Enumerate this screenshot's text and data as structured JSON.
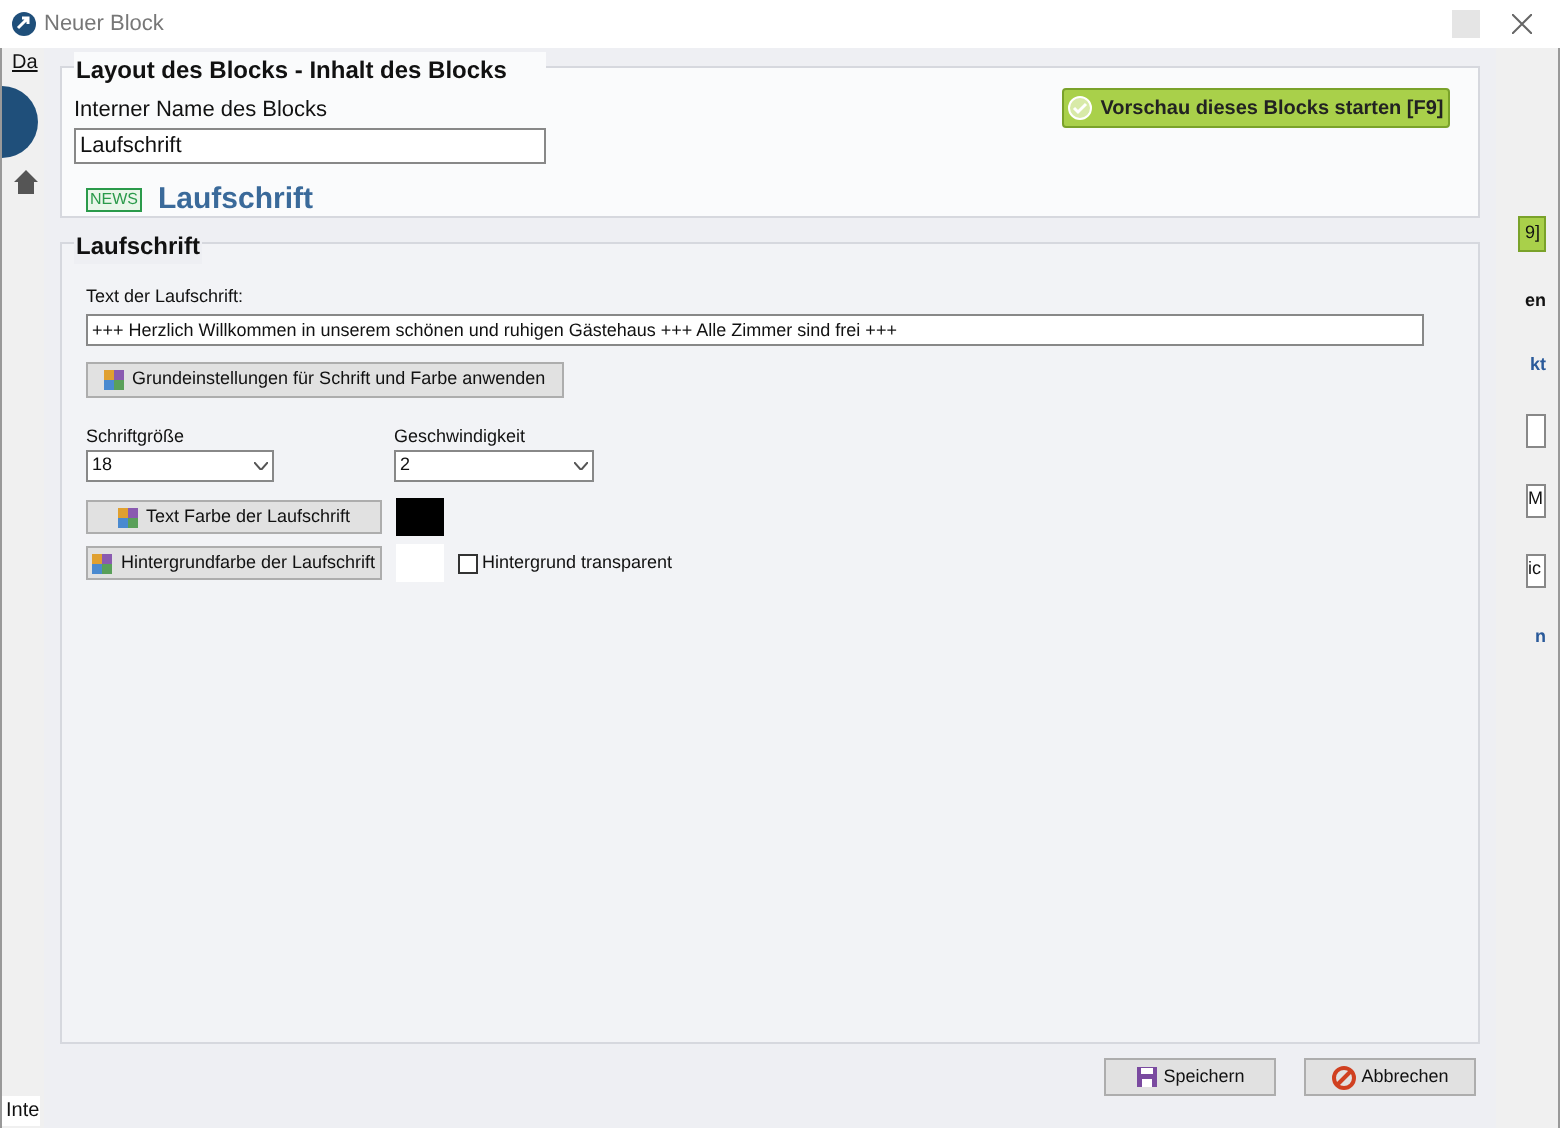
{
  "window": {
    "title": "Neuer Block"
  },
  "background_app": {
    "menu": "Da",
    "status": "Inte",
    "right_texts": [
      {
        "kind": "button",
        "text": "9]"
      },
      {
        "kind": "heading",
        "text": "en"
      },
      {
        "kind": "link",
        "text": "kt"
      },
      {
        "kind": "field"
      },
      {
        "kind": "field",
        "text": "M"
      },
      {
        "kind": "field",
        "text": "ic"
      },
      {
        "kind": "link",
        "text": "n"
      }
    ]
  },
  "layout_group": {
    "title": "Layout des Blocks - Inhalt des Blocks",
    "name_label": "Interner Name des Blocks",
    "name_value": "Laufschrift",
    "preview_button": "Vorschau dieses Blocks starten [F9]",
    "badge": "NEWS",
    "block_type": "Laufschrift"
  },
  "ticker_group": {
    "title": "Laufschrift",
    "text_label": "Text der Laufschrift:",
    "text_value": "+++ Herzlich Willkommen in unserem schönen und ruhigen Gästehaus +++ Alle Zimmer sind frei +++",
    "defaults_button": "Grundeinstellungen für Schrift und Farbe anwenden",
    "font_size": {
      "label": "Schriftgröße",
      "value": "18"
    },
    "speed": {
      "label": "Geschwindigkeit",
      "value": "2"
    },
    "text_color": {
      "button": "Text Farbe der Laufschrift",
      "color": "#000000"
    },
    "background_color": {
      "button": "Hintergrundfarbe der Laufschrift",
      "color": "#ffffff"
    },
    "transparent": {
      "label": "Hintergrund transparent",
      "checked": false
    }
  },
  "buttons": [
    {
      "kind": "save",
      "label": "Speichern"
    },
    {
      "kind": "cancel",
      "label": "Abbrechen"
    }
  ]
}
